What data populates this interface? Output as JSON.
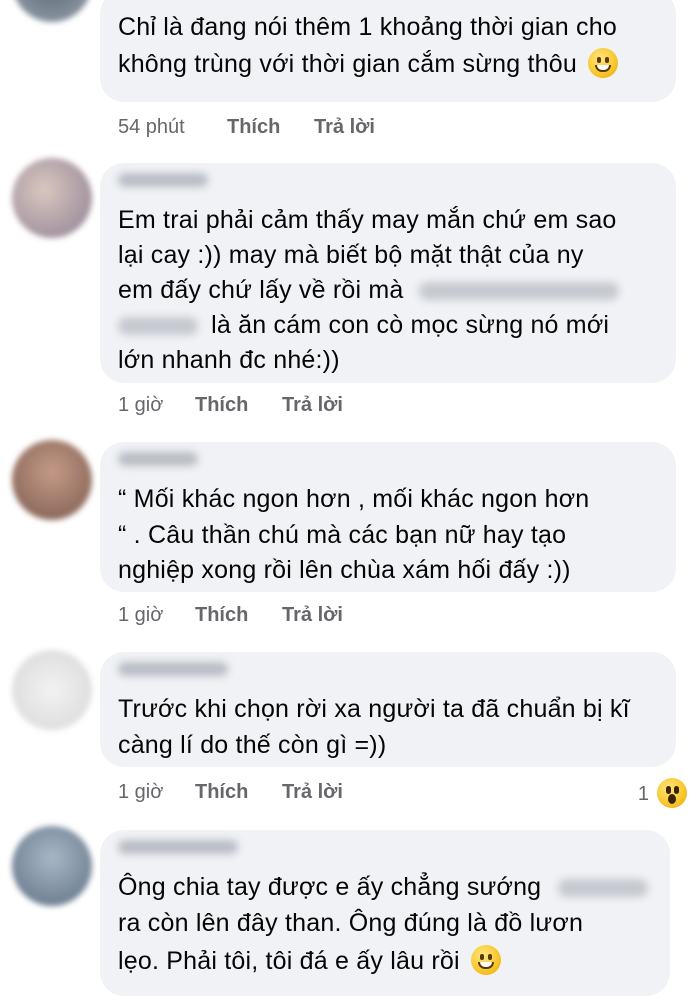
{
  "comments": [
    {
      "lines": [
        "Chỉ là đang nói thêm 1 khoảng thời gian cho",
        "không trùng với thời gian cắm sừng thôu"
      ],
      "time": "54 phút",
      "like": "Thích",
      "reply": "Trả lời",
      "emoji": "grinning-face-icon"
    },
    {
      "lines": [
        "Em trai phải cảm thấy may mắn chứ em sao",
        "lại cay :)) may mà biết bộ mặt thật của ny",
        "em đấy chứ lấy về rồi mà",
        "là ăn cám  con cò mọc sừng nó mới",
        "lớn nhanh đc nhé:))"
      ],
      "time": "1 giờ",
      "like": "Thích",
      "reply": "Trả lời"
    },
    {
      "lines": [
        "“ Mối khác ngon hơn , mối khác ngon hơn",
        "“ . Câu thần chú mà các bạn nữ hay tạo",
        "nghiệp xong rồi lên chùa xám hối đấy :))"
      ],
      "time": "1 giờ",
      "like": "Thích",
      "reply": "Trả lời"
    },
    {
      "lines": [
        "Trước khi chọn rời xa người ta đã chuẩn bị kĩ",
        "càng lí do thế còn gì =))"
      ],
      "time": "1 giờ",
      "like": "Thích",
      "reply": "Trả lời",
      "reaction_count": "1",
      "reaction": "wow-face-icon"
    },
    {
      "lines": [
        "Ông chia tay được e ấy chẳng sướng",
        "ra còn lên đây than. Ông đúng là đồ lươn",
        "lẹo. Phải tôi, tôi đá e ấy lâu rồi"
      ],
      "time": "",
      "emoji": "grinning-face-icon"
    }
  ]
}
